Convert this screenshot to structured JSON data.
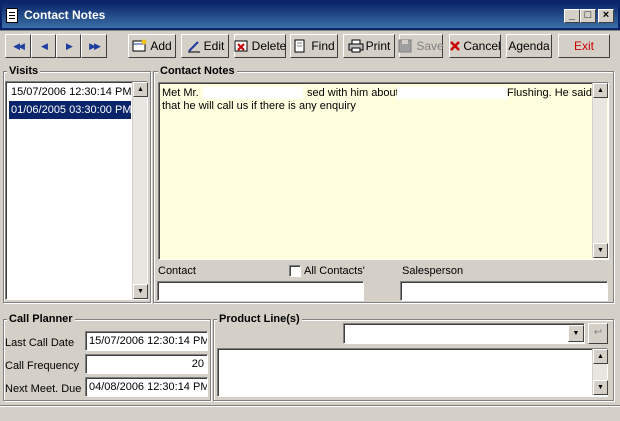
{
  "window": {
    "title": "Contact Notes",
    "controls": {
      "minimize": "_",
      "maximize": "□",
      "close": "×"
    }
  },
  "toolbar": {
    "nav": {
      "first": "◀◀",
      "prev": "◀",
      "next": "▶",
      "last": "▶▶"
    },
    "add": "Add",
    "edit": "Edit",
    "delete": "Delete",
    "find": "Find",
    "print": "Print",
    "save": "Save",
    "cancel": "Cancel",
    "agenda": "Agenda",
    "exit": "Exit"
  },
  "visits": {
    "label": "Visits",
    "items": [
      {
        "text": "15/07/2006 12:30:14 PM",
        "selected": false
      },
      {
        "text": "01/06/2005 03:30:00 PM",
        "selected": true
      }
    ]
  },
  "contact_notes": {
    "label": "Contact Notes",
    "text_line1_a": "Met Mr.",
    "text_line1_b": "sed with him about",
    "text_line1_c": "Flushing. He said",
    "text_line2": "that he will call us if there is any enquiry"
  },
  "contact": {
    "label": "Contact",
    "value": ""
  },
  "all_contacts": {
    "label": "All Contacts'",
    "checked": false
  },
  "salesperson": {
    "label": "Salesperson",
    "value": ""
  },
  "call_planner": {
    "label": "Call Planner",
    "last_call_date": {
      "label": "Last Call Date",
      "value": "15/07/2006 12:30:14 PM"
    },
    "call_frequency": {
      "label": "Call Frequency",
      "value": "20"
    },
    "next_meet_due": {
      "label": "Next Meet. Due",
      "value": "04/08/2006 12:30:14 PM"
    }
  },
  "product_lines": {
    "label": "Product Line(s)",
    "selected": ""
  },
  "colors": {
    "title_bar": "#0a246a",
    "face": "#d4d0c8",
    "selection": "#0a246a",
    "notes_background": "#ffffe0",
    "exit_text": "#cc0000"
  }
}
